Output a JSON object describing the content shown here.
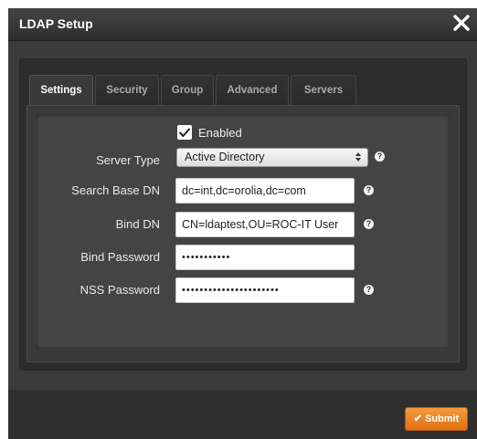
{
  "window": {
    "title": "LDAP Setup",
    "close_icon": "close-icon"
  },
  "tabs": [
    {
      "label": "Settings",
      "active": true
    },
    {
      "label": "Security",
      "active": false
    },
    {
      "label": "Group",
      "active": false
    },
    {
      "label": "Advanced",
      "active": false
    },
    {
      "label": "Servers",
      "active": false
    }
  ],
  "form": {
    "enabled": {
      "label": "Enabled",
      "checked": true
    },
    "server_type": {
      "label": "Server Type",
      "value": "Active Directory"
    },
    "search_base_dn": {
      "label": "Search Base DN",
      "value": "dc=int,dc=orolia,dc=com"
    },
    "bind_dn": {
      "label": "Bind DN",
      "value": "CN=ldaptest,OU=ROC-IT User"
    },
    "bind_password": {
      "label": "Bind Password",
      "value": "•••••••••••"
    },
    "nss_password": {
      "label": "NSS Password",
      "value": "••••••••••••••••••••••"
    },
    "help_glyph": "?"
  },
  "footer": {
    "submit_label": "Submit"
  },
  "colors": {
    "accent": "#f08a24",
    "background": "#3b3b3b",
    "panel": "#2d2d2d"
  }
}
